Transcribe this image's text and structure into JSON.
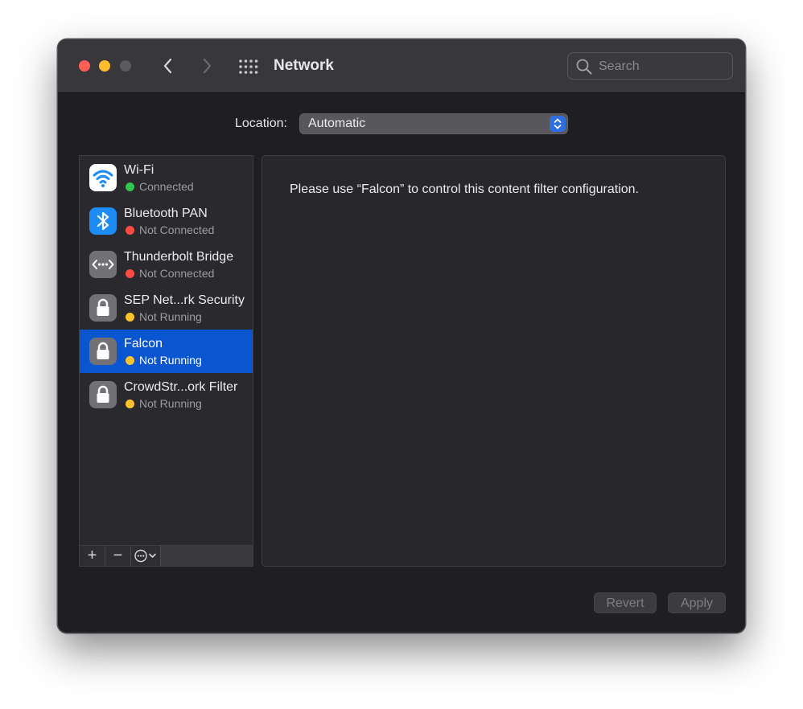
{
  "window": {
    "title": "Network",
    "traffic_lights": [
      "close",
      "minimize",
      "zoom-disabled"
    ]
  },
  "toolbar": {
    "back_icon": "chevron-left-icon",
    "forward_icon": "chevron-right-icon",
    "grid_icon": "grid-icon"
  },
  "search": {
    "placeholder": "Search",
    "value": ""
  },
  "location": {
    "label": "Location:",
    "value": "Automatic"
  },
  "services": [
    {
      "name": "Wi-Fi",
      "status": "Connected",
      "status_color": "#31c552",
      "icon": "wifi-icon",
      "icon_bg": "#ffffff",
      "selected": false
    },
    {
      "name": "Bluetooth PAN",
      "status": "Not Connected",
      "status_color": "#fe4c44",
      "icon": "bluetooth-icon",
      "icon_bg": "#1e8cf5",
      "selected": false
    },
    {
      "name": "Thunderbolt Bridge",
      "status": "Not Connected",
      "status_color": "#fe4c44",
      "icon": "thunderbolt-bridge-icon",
      "icon_bg": "#727176",
      "selected": false
    },
    {
      "name": "SEP Net...rk Security",
      "status": "Not Running",
      "status_color": "#fec22e",
      "icon": "lock-icon",
      "icon_bg": "#727176",
      "selected": false
    },
    {
      "name": "Falcon",
      "status": "Not Running",
      "status_color": "#fec22e",
      "icon": "lock-icon",
      "icon_bg": "#727176",
      "selected": true
    },
    {
      "name": "CrowdStr...ork Filter",
      "status": "Not Running",
      "status_color": "#fec22e",
      "icon": "lock-icon",
      "icon_bg": "#727176",
      "selected": false
    }
  ],
  "sidebar_toolbar": {
    "add_label": "+",
    "remove_label": "−",
    "action_icon": "ellipsis-circle-icon"
  },
  "detail": {
    "message": "Please use “Falcon” to control this content filter configuration."
  },
  "buttons": {
    "revert_label": "Revert",
    "apply_label": "Apply"
  },
  "colors": {
    "selection": "#0a55d0",
    "accent": "#2d6ee0"
  }
}
